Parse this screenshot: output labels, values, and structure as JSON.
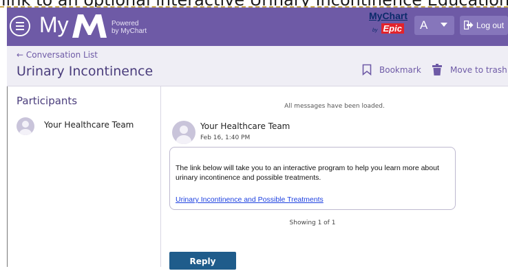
{
  "page_top": {
    "cut_text": "link to an optional interactive Urinary Incontinence Education"
  },
  "header": {
    "brand_my": "My",
    "powered_line1": "Powered",
    "powered_line2": "by MyChart",
    "mychart_logo": "MyChart",
    "mychart_by": "by",
    "epic_logo": "Epic",
    "user_initial": "A",
    "logout_label": "Log out",
    "bg_color": "#6e5aa6"
  },
  "subheader": {
    "back_label": "← Conversation List",
    "title": "Urinary Incontinence",
    "bookmark_label": "Bookmark",
    "trash_label": "Move to trash"
  },
  "sidebar": {
    "heading": "Participants",
    "participants": [
      {
        "name": "Your Healthcare Team"
      }
    ]
  },
  "thread": {
    "loaded_note": "All messages have been loaded.",
    "messages": [
      {
        "sender": "Your Healthcare Team",
        "timestamp": "Feb 16, 1:40 PM",
        "body": "The link below will take you to an interactive program to help you learn more about urinary incontinence and possible treatments.",
        "link_text": "Urinary Incontinence and Possible Treatments"
      }
    ],
    "showing": "Showing 1 of 1",
    "reply_label": "Reply"
  },
  "icons": {
    "menu": "hamburger-menu-icon",
    "logout": "logout-arrow-icon",
    "bookmark": "bookmark-icon",
    "trash": "trash-icon",
    "avatar": "person-avatar-icon"
  }
}
